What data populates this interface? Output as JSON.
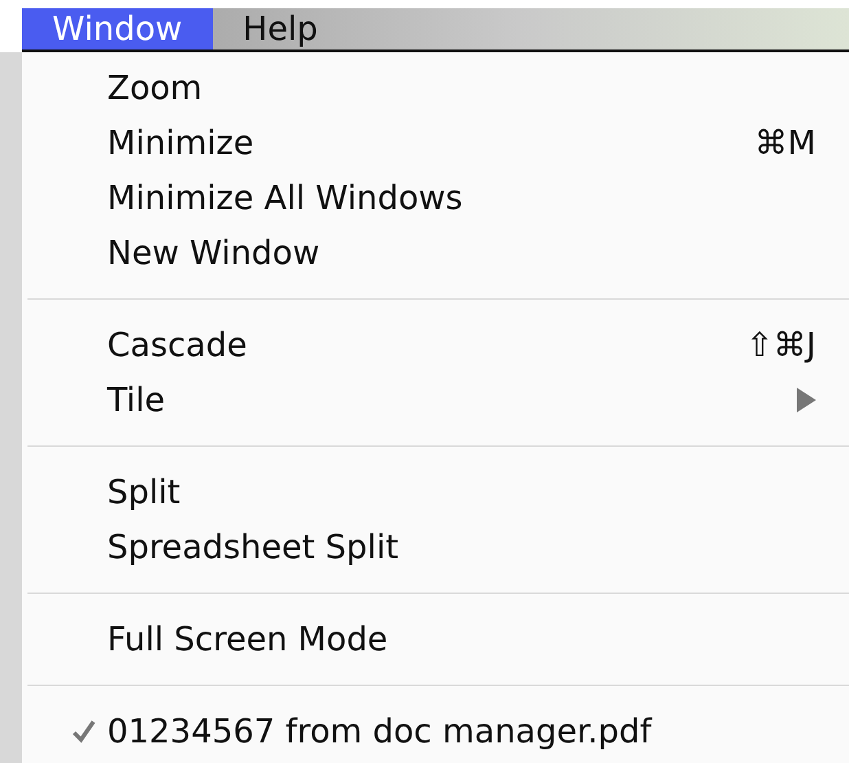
{
  "menu_bar": [
    {
      "label": "Window",
      "selected": true
    },
    {
      "label": "Help",
      "selected": false
    }
  ],
  "menu": {
    "groups": [
      [
        {
          "label": "Zoom",
          "checked": false,
          "submenu": false
        },
        {
          "label": "Minimize",
          "shortcut": "⌘M",
          "checked": false,
          "submenu": false
        },
        {
          "label": "Minimize All Windows",
          "checked": false,
          "submenu": false
        },
        {
          "label": "New Window",
          "checked": false,
          "submenu": false
        }
      ],
      [
        {
          "label": "Cascade",
          "shortcut": "⇧⌘J",
          "checked": false,
          "submenu": false
        },
        {
          "label": "Tile",
          "checked": false,
          "submenu": true
        }
      ],
      [
        {
          "label": "Split",
          "checked": false,
          "submenu": false
        },
        {
          "label": "Spreadsheet Split",
          "checked": false,
          "submenu": false
        }
      ],
      [
        {
          "label": "Full Screen Mode",
          "checked": false,
          "submenu": false
        }
      ],
      [
        {
          "label": "01234567 from doc manager.pdf",
          "checked": true,
          "submenu": false
        }
      ]
    ]
  }
}
